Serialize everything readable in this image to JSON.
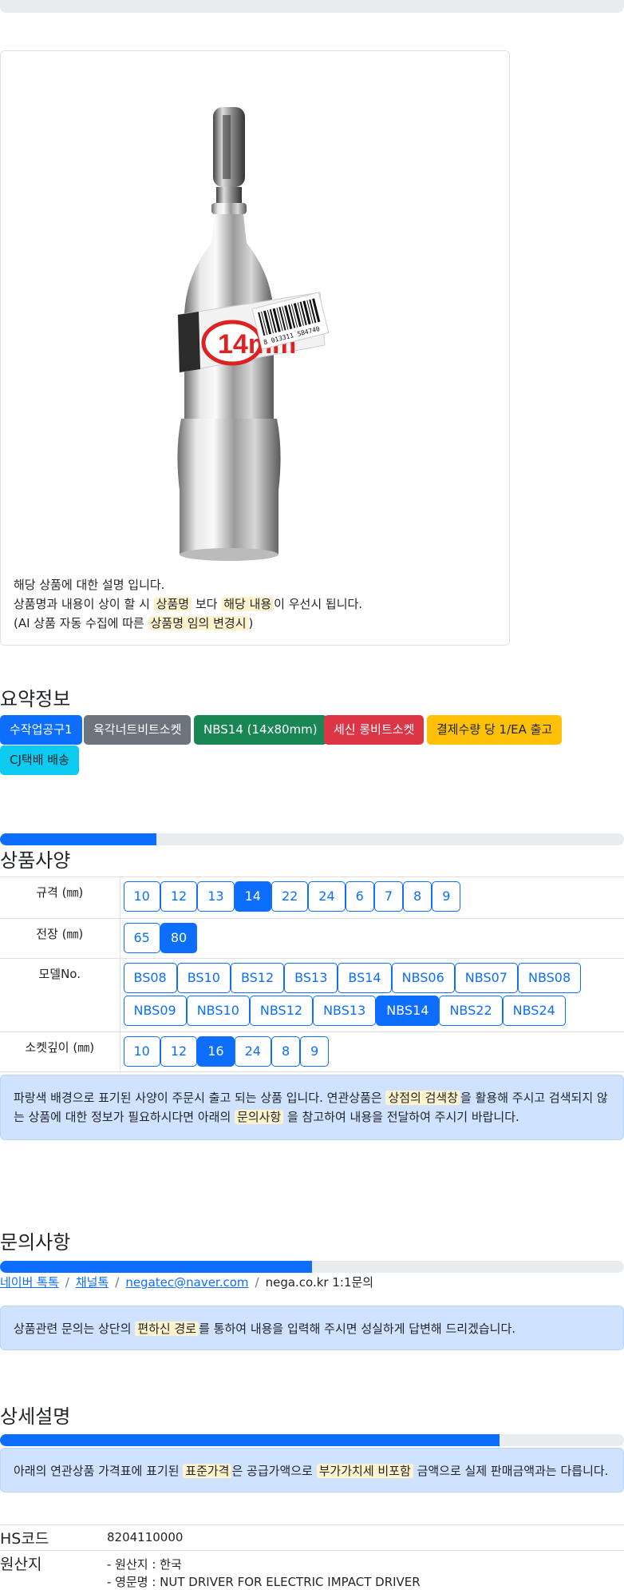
{
  "product": {
    "description_lines": [
      {
        "parts": [
          "해당 상품에 대한 설명 입니다."
        ]
      },
      {
        "parts": [
          "상품명과 내용이 상이 할 시 ",
          "상품명",
          " 보다 ",
          "해당 내용",
          "이 우선시 됩니다."
        ]
      },
      {
        "parts": [
          "(AI 상품 자동 수집에 따른 ",
          "상품명 임의 변경시",
          ")"
        ]
      }
    ],
    "label_text": "14mm",
    "barcode_text": "8 013311 584740"
  },
  "summary": {
    "title": "요약정보",
    "badges": [
      {
        "label": "수작업공구1",
        "color": "#0d6efd"
      },
      {
        "label": "육각너트비트소켓",
        "color": "#6c757d"
      },
      {
        "label": "NBS14 (14x80mm)",
        "color": "#198754"
      },
      {
        "label": "세신 롱비트소켓",
        "color": "#dc3545"
      },
      {
        "label": "결제수량 당 1/EA 출고",
        "color": "#ffc107"
      },
      {
        "label": "CJ택배 배송",
        "color": "#0dcaf0"
      }
    ]
  },
  "spec": {
    "title": "상품사양",
    "progress": 0.25,
    "rows": [
      {
        "label": "규격 (㎜)",
        "options": [
          "10",
          "12",
          "13",
          "14",
          "22",
          "24",
          "6",
          "7",
          "8",
          "9"
        ],
        "selected": "14"
      },
      {
        "label": "전장 (㎜)",
        "options": [
          "65",
          "80"
        ],
        "selected": "80"
      },
      {
        "label": "모델No.",
        "options": [
          "BS08",
          "BS10",
          "BS12",
          "BS13",
          "BS14",
          "NBS06",
          "NBS07",
          "NBS08",
          "NBS09",
          "NBS10",
          "NBS12",
          "NBS13",
          "NBS14",
          "NBS22",
          "NBS24"
        ],
        "selected": "NBS14"
      },
      {
        "label": "소켓깊이 (㎜)",
        "options": [
          "10",
          "12",
          "16",
          "24",
          "8",
          "9"
        ],
        "selected": "16"
      }
    ],
    "notice_parts": [
      "파랑색 배경으로 표기된 사양이 주문시 출고 되는 상품 입니다. 연관상품은 ",
      "상점의 검색창",
      "을 활용해 주시고 검색되지 않는 상품에 대한 정보가 필요하시다면 아래의 ",
      "문의사항",
      " 을 참고하여 내용을 전달하여 주시기 바랍니다."
    ]
  },
  "inquiry": {
    "title": "문의사항",
    "progress": 0.5,
    "links": [
      "네이버 톡톡",
      "채널톡",
      "negatec@naver.com"
    ],
    "plain_link": "nega.co.kr 1:1문의",
    "separator": "/",
    "notice_parts": [
      "상품관련 문의는 상단의 ",
      "편하신 경로",
      "를 통하여 내용을 입력해 주시면 성실하게 답변해 드리겠습니다."
    ]
  },
  "detail": {
    "title": "상세설명",
    "progress": 0.8,
    "notice_parts": [
      "아래의 연관상품 가격표에 표기된 ",
      "표준가격",
      "은 공급가액으로 ",
      "부가가치세 비포함",
      " 금액으로 실제 판매금액과는 다릅니다."
    ],
    "hs_label": "HS코드",
    "hs_value": "8204110000",
    "origin_label": "원산지",
    "origin_lines": [
      "- 원산지 : 한국",
      "- 영문명 : NUT DRIVER FOR ELECTRIC IMPACT DRIVER"
    ]
  }
}
